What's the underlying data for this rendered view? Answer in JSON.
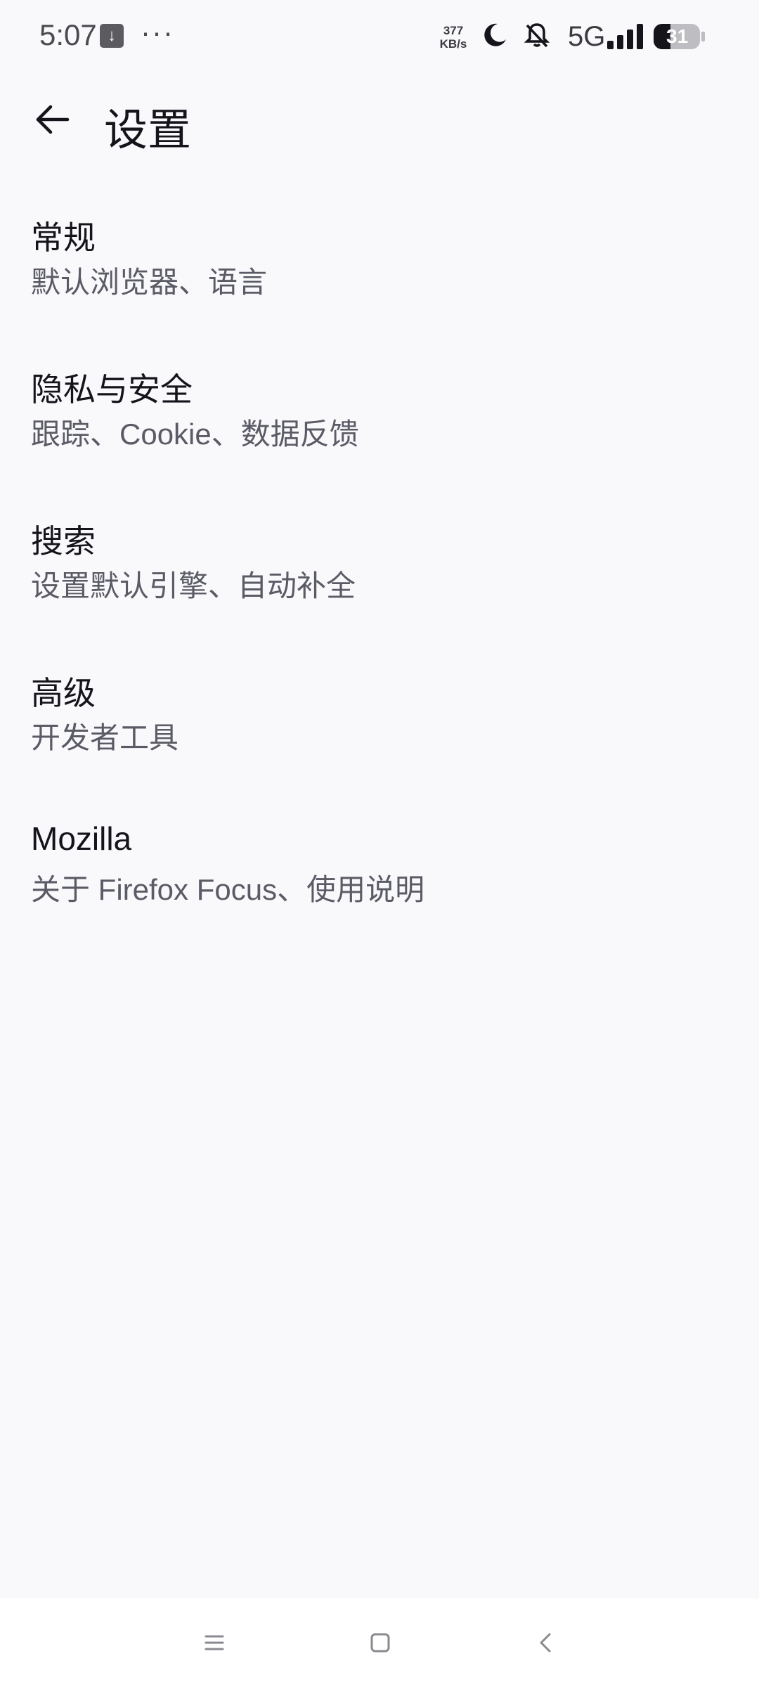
{
  "status_bar": {
    "time": "5:07",
    "download_glyph": "↓",
    "more": "···",
    "net_speed_value": "377",
    "net_speed_unit": "KB/s",
    "network": "5G",
    "battery": "31",
    "icons": [
      "download-icon",
      "moon-icon",
      "bell-off-icon",
      "signal-icon",
      "battery-icon"
    ]
  },
  "app_bar": {
    "title": "设置",
    "back_icon": "arrow-left-icon"
  },
  "settings": {
    "items": [
      {
        "title": "常规",
        "subtitle": "默认浏览器、语言"
      },
      {
        "title": "隐私与安全",
        "subtitle": "跟踪、Cookie、数据反馈"
      },
      {
        "title": "搜索",
        "subtitle": "设置默认引擎、自动补全"
      },
      {
        "title": "高级",
        "subtitle": "开发者工具"
      },
      {
        "title": "Mozilla",
        "subtitle": "关于 Firefox Focus、使用说明"
      }
    ]
  },
  "nav_bar": {
    "icons": [
      "menu-icon",
      "home-icon",
      "back-icon"
    ]
  },
  "colors": {
    "background": "#f9f9fc",
    "title_text": "#15141a",
    "subtitle_text": "#5b5b66"
  }
}
